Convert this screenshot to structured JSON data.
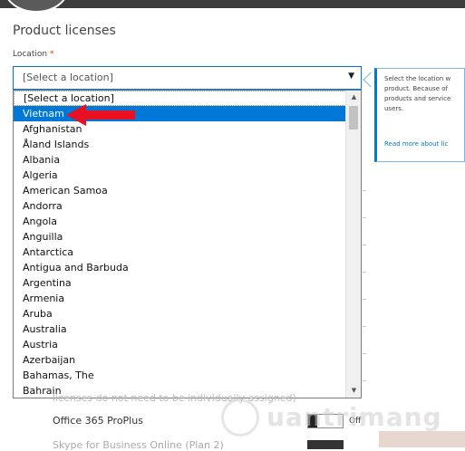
{
  "header": {
    "title": "Product licenses"
  },
  "location": {
    "label": "Location",
    "required_mark": "*",
    "selected_value": "[Select a location]"
  },
  "dropdown": {
    "items": [
      "[Select a location]",
      "Vietnam",
      "Afghanistan",
      "Åland Islands",
      "Albania",
      "Algeria",
      "American Samoa",
      "Andorra",
      "Angola",
      "Anguilla",
      "Antarctica",
      "Antigua and Barbuda",
      "Argentina",
      "Armenia",
      "Aruba",
      "Australia",
      "Austria",
      "Azerbaijan",
      "Bahamas, The",
      "Bahrain"
    ],
    "highlighted_item": "Vietnam"
  },
  "help": {
    "lines": [
      "Select the location w",
      "product. Because of",
      "products and service",
      "users."
    ],
    "link": "Read more about lic"
  },
  "background": {
    "partial_text": "licenses do not need to be individually assigned)",
    "product_name": "Office 365 ProPlus",
    "toggle_label": "Off",
    "product_name_2": "Skype for Business Online (Plan 2)"
  },
  "watermark": {
    "text": "uantrimang"
  },
  "colors": {
    "accent": "#0078d7",
    "arrow": "#e81123",
    "topbar": "#3c3c3c"
  }
}
